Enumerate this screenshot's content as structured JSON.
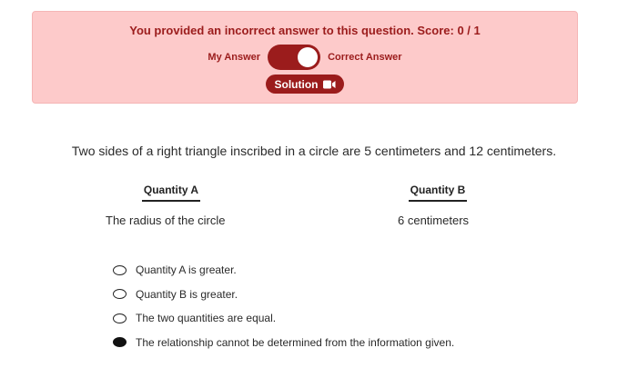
{
  "feedback": {
    "message": "You provided an incorrect answer to this question. Score: 0 / 1",
    "toggle_left_label": "My Answer",
    "toggle_right_label": "Correct Answer",
    "toggle_state": "correct-answer",
    "solution_label": "Solution",
    "accent_color": "#9b1c1c",
    "background_color": "#fdcaca"
  },
  "question": {
    "text": "Two sides of a right triangle inscribed in a circle are 5 centimeters and 12 centimeters."
  },
  "quantities": {
    "a_header": "Quantity A",
    "b_header": "Quantity B",
    "a_value": "The radius of the circle",
    "b_value": "6 centimeters"
  },
  "options": [
    {
      "label": "Quantity A is greater.",
      "selected": false
    },
    {
      "label": "Quantity B is greater.",
      "selected": false
    },
    {
      "label": "The two quantities are equal.",
      "selected": false
    },
    {
      "label": "The relationship cannot be determined from the information given.",
      "selected": true
    }
  ]
}
